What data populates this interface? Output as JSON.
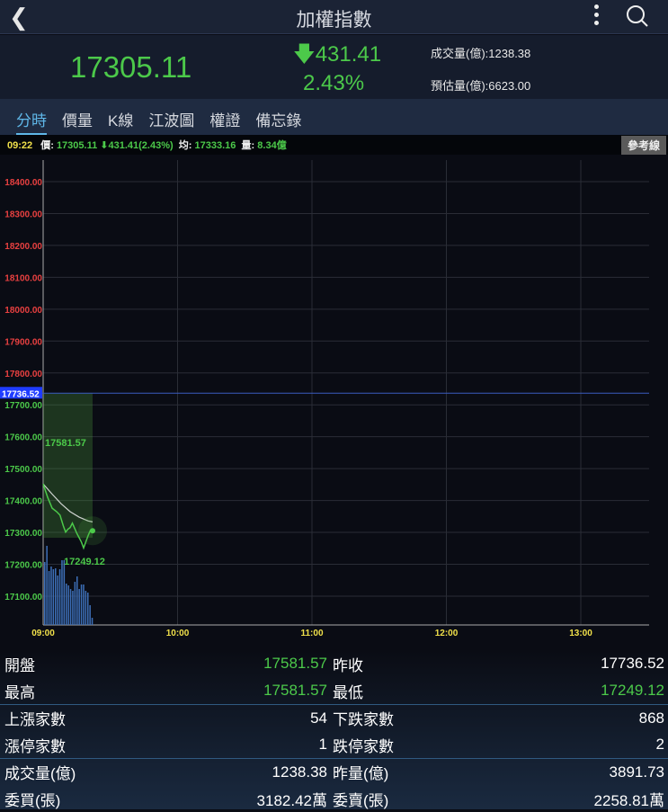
{
  "header": {
    "title": "加權指數"
  },
  "quote": {
    "price": "17305.11",
    "change": "431.41",
    "percent": "2.43%",
    "volume": "成交量(億):1238.38",
    "estimate": "預估量(億):6623.00"
  },
  "tabs": [
    "分時",
    "價量",
    "K線",
    "江波圖",
    "權證",
    "備忘錄"
  ],
  "infobar": {
    "time": "09:22",
    "price_label": "價:",
    "price": "17305.11",
    "change": "⬇431.41(2.43%)",
    "avg_label": "均:",
    "avg": "17333.16",
    "vol_label": "量:",
    "vol": "8.34億",
    "ref_button": "參考線"
  },
  "colors": {
    "up": "#e84040",
    "down": "#4cc94a",
    "ref": "#1f3cff"
  },
  "chart_data": {
    "type": "line",
    "x_ticks": [
      "09:00",
      "10:00",
      "11:00",
      "12:00",
      "13:00"
    ],
    "y_ticks": [
      "18400.00",
      "18300.00",
      "18200.00",
      "18100.00",
      "18000.00",
      "17900.00",
      "17800.00",
      "17700.00",
      "17600.00",
      "17500.00",
      "17400.00",
      "17300.00",
      "17200.00",
      "17100.00"
    ],
    "y_range": [
      17016,
      18400
    ],
    "x_range_minutes": [
      0,
      270
    ],
    "reference": "17736.52",
    "open_label": "17581.57",
    "low_label": "17249.12",
    "price_series": [
      [
        0,
        17452
      ],
      [
        2,
        17410
      ],
      [
        4,
        17376
      ],
      [
        6,
        17365
      ],
      [
        7.5,
        17354
      ],
      [
        9,
        17320
      ],
      [
        10,
        17301
      ],
      [
        11,
        17310
      ],
      [
        12,
        17315
      ],
      [
        13,
        17329
      ],
      [
        15,
        17297
      ],
      [
        17,
        17270
      ],
      [
        18,
        17251
      ],
      [
        20,
        17290
      ],
      [
        21,
        17306
      ],
      [
        22,
        17305
      ]
    ],
    "avg_series": [
      [
        0,
        17452
      ],
      [
        4,
        17420
      ],
      [
        8,
        17390
      ],
      [
        12,
        17365
      ],
      [
        16,
        17348
      ],
      [
        20,
        17336
      ],
      [
        22,
        17333
      ]
    ],
    "volume": [
      70,
      88,
      60,
      65,
      62,
      63,
      55,
      62,
      72,
      72,
      46,
      44,
      40,
      38,
      48,
      54,
      40,
      45,
      45,
      38,
      36,
      22,
      8
    ]
  },
  "stats": [
    {
      "l": "開盤",
      "v": "17581.57",
      "l2": "昨收",
      "v2": "17736.52"
    },
    {
      "l": "最高",
      "v": "17581.57",
      "l2": "最低",
      "v2": "17249.12"
    },
    {
      "l": "上漲家數",
      "v": "54",
      "l2": "下跌家數",
      "v2": "868"
    },
    {
      "l": "漲停家數",
      "v": "1",
      "l2": "跌停家數",
      "v2": "2"
    },
    {
      "l": "成交量(億)",
      "v": "1238.38",
      "l2": "昨量(億)",
      "v2": "3891.73"
    },
    {
      "l": "委買(張)",
      "v": "3182.42萬",
      "l2": "委賣(張)",
      "v2": "2258.81萬"
    }
  ]
}
